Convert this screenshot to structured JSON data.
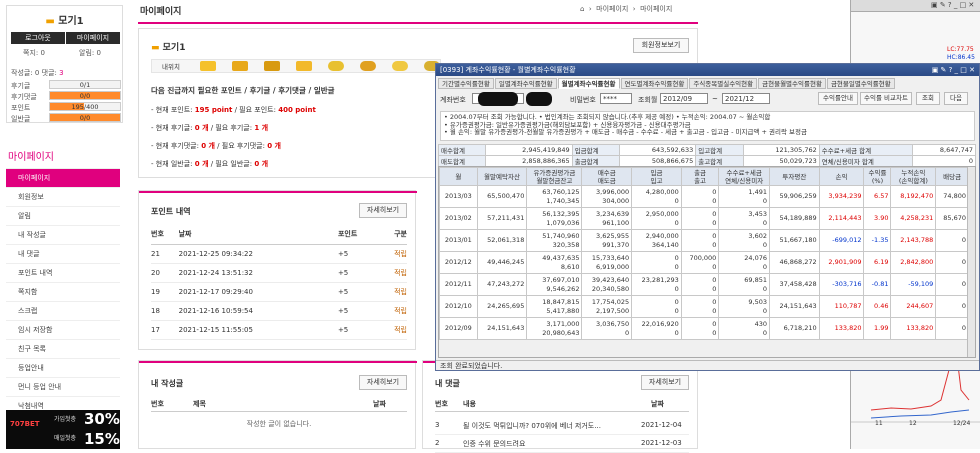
{
  "sidebar": {
    "nickname": "모기1",
    "logout": "로그아웃",
    "mypage_btn": "마이페이지",
    "scrap_label": "쪽지:",
    "scrap_count": "0",
    "share_label": "알림:",
    "share_count": "0",
    "post_label": "작성글:",
    "post_count": "0",
    "comment_label": "댓글:",
    "comment_count": "3",
    "stats": [
      {
        "label": "후기글",
        "bar": "0/1",
        "fill": 0
      },
      {
        "label": "후기댓글",
        "bar": "0/0",
        "fill": 1
      },
      {
        "label": "포인트",
        "bar": "195/400",
        "fill": 0.49
      },
      {
        "label": "일반글",
        "bar": "0/0",
        "fill": 1
      }
    ],
    "section_title": "마이페이지",
    "menu": [
      "마이페이지",
      "회원정보",
      "알림",
      "내 작성글",
      "내 댓글",
      "포인트 내역",
      "쪽지함",
      "스크랩",
      "임시 저장함",
      "친구 목록",
      "등업안내",
      "먼니 등업 안내",
      "낙첨내역"
    ],
    "ad_line1": "가입첫충",
    "ad_pct1": "30%",
    "ad_line2": "매일첫충",
    "ad_pct2": "15%",
    "ad_brand": "707BET"
  },
  "main": {
    "page_title": "마이페이지",
    "crumb1": "마이페이지",
    "crumb2": "마이페이지",
    "home_icon": "home-icon",
    "user": "모기1",
    "profile_btn": "회원정보보기",
    "tab_first": "내위치",
    "next_level": "다음 진급까지 필요한 포인트 / 후기글 / 후기댓글 / 일반글",
    "cur_point_a": "- 현재 포인트: ",
    "cur_point_v": "195 point",
    "cur_point_b": " / 필요 포인트: ",
    "need_point_v": "400 point",
    "rev_a": "- 현재 후기글: ",
    "rev_v": "0 개",
    "rev_b": " / 필요 후기글: ",
    "rev_need": "1 개",
    "revc_a": "- 현재 후기댓글: ",
    "revc_v": "0 개",
    "revc_b": " / 필요 후기댓글: ",
    "revc_need": "0 개",
    "gen_a": "- 현재 일반글: ",
    "gen_v": "0 개",
    "gen_b": " / 필요 일반글: ",
    "gen_need": "0 개",
    "points_title": "포인트 내역",
    "more": "자세히보기",
    "points_cols": [
      "번호",
      "날짜",
      "포인트",
      "구분"
    ],
    "points": [
      [
        "21",
        "2021-12-25 09:34:22",
        "+5",
        "적립"
      ],
      [
        "20",
        "2021-12-24 13:51:32",
        "+5",
        "적립"
      ],
      [
        "19",
        "2021-12-17 09:29:40",
        "+5",
        "적립"
      ],
      [
        "18",
        "2021-12-16 10:59:54",
        "+5",
        "적립"
      ],
      [
        "17",
        "2021-12-15 11:55:05",
        "+5",
        "적립"
      ]
    ],
    "posts_title": "내 작성글",
    "posts_cols": [
      "번호",
      "제목",
      "날짜"
    ],
    "posts_empty": "작성한 글이 없습니다.",
    "comments_title": "내 댓글",
    "comments_cols": [
      "번호",
      "내용",
      "날짜"
    ],
    "comments": [
      [
        "3",
        "될 이것도 먹튀입니까? 070위에 베너 저거도...",
        "2021-12-04"
      ],
      [
        "2",
        "인증 수위 문의드려요",
        "2021-12-03"
      ]
    ]
  },
  "dialog": {
    "title": "[0393] 계좌수익률현황 - 월별계좌수익률현황",
    "tabs": [
      "기간별수익률현황",
      "일별계좌수익률현황",
      "월별계좌수익률현황",
      "연도별계좌수익률현황",
      "주식종목별실수익현황",
      "금현물월별수익률현황",
      "금현물일별수익률현황"
    ],
    "acct_label": "계좌번호",
    "pw_label": "비밀번호",
    "pw_value": "****",
    "period_label": "조회월",
    "from": "2012/09",
    "tilde": "~",
    "to": "2021/12",
    "btn_guide": "수익률안내",
    "btn_compare": "수익률 비교차트",
    "btn_query": "조회",
    "btn_next": "다음",
    "notes": [
      "• 2004.07부터 조회 가능합니다.   • 법인계좌는 조회되지 않습니다.(추후 제공 예정)   • 누적손익: 2004.07 ~ 월손익합",
      "• 유가증권평가금: 일반유가증권평가금(해외담보포함) + 신용융자평가금 - 신용대주평가금",
      "• 월 손익: 월말 유가증권평가-전월말 유가증권평가 + 매도금 - 매수금 - 수수료 - 세금 + 출고금 - 입고금 - 미지급액 + 권리락 보정금"
    ],
    "sum": [
      [
        "매수합계",
        "2,945,419,849",
        "입금합계",
        "643,592,633",
        "입고합계",
        "121,305,762",
        "수수료+세금 합계",
        "8,647,747"
      ],
      [
        "매도합계",
        "2,858,886,365",
        "출금합계",
        "508,866,675",
        "출고합계",
        "50,029,723",
        "연체/신용미자 합계",
        "0"
      ]
    ],
    "cols": [
      "월",
      "월말예탁자산",
      "유가증권평가금\n월말현금잔고",
      "매수금\n매도금",
      "입금\n입고",
      "출금\n출고",
      "수수료+세금\n연체/신용미자",
      "투자평잔",
      "손익",
      "수익률\n(%)",
      "누적손익\n(손익합계)",
      "배당금"
    ],
    "rows": [
      [
        "2013/03",
        "65,500,470",
        "63,760,125\n1,740,345",
        "3,996,000\n304,000",
        "4,280,000\n0",
        "0\n0",
        "1,491\n0",
        "59,906,259",
        "3,934,239",
        "6.57",
        "8,192,470",
        "74,800"
      ],
      [
        "2013/02",
        "57,211,431",
        "56,132,395\n1,079,036",
        "3,234,639\n961,100",
        "2,950,000\n0",
        "0\n0",
        "3,453\n0",
        "54,189,889",
        "2,114,443",
        "3.90",
        "4,258,231",
        "85,670"
      ],
      [
        "2013/01",
        "52,061,318",
        "51,740,960\n320,358",
        "3,625,955\n991,370",
        "2,940,000\n364,140",
        "0\n0",
        "3,602\n0",
        "51,667,180",
        "-699,012",
        "-1.35",
        "2,143,788",
        "0"
      ],
      [
        "2012/12",
        "49,446,245",
        "49,437,635\n8,610",
        "15,733,640\n6,919,000",
        "0\n0",
        "700,000\n0",
        "24,076\n0",
        "46,868,272",
        "2,901,909",
        "6.19",
        "2,842,800",
        "0"
      ],
      [
        "2012/11",
        "47,243,272",
        "37,697,010\n9,546,262",
        "39,423,640\n20,340,580",
        "23,281,293\n0",
        "0\n0",
        "69,851\n0",
        "37,458,428",
        "-303,716",
        "-0.81",
        "-59,109",
        "0"
      ],
      [
        "2012/10",
        "24,265,695",
        "18,847,815\n5,417,880",
        "17,754,025\n2,197,500",
        "0\n0",
        "0\n0",
        "9,503\n0",
        "24,151,643",
        "110,787",
        "0.46",
        "244,607",
        "0"
      ],
      [
        "2012/09",
        "24,151,643",
        "3,171,000\n20,980,643",
        "3,036,750\n0",
        "22,016,920\n0",
        "0\n0",
        "430\n0",
        "6,718,210",
        "133,820",
        "1.99",
        "133,820",
        "0"
      ]
    ],
    "status": "조회 완료되었습니다."
  },
  "chart": {
    "labels": [
      "LC:77.75",
      "HC:86.45"
    ],
    "x_ticks": [
      "11",
      "12",
      "12/24"
    ]
  },
  "colors": {
    "accent": "#e0007e",
    "orange": "#ff8a2b",
    "link": "#c06000"
  }
}
